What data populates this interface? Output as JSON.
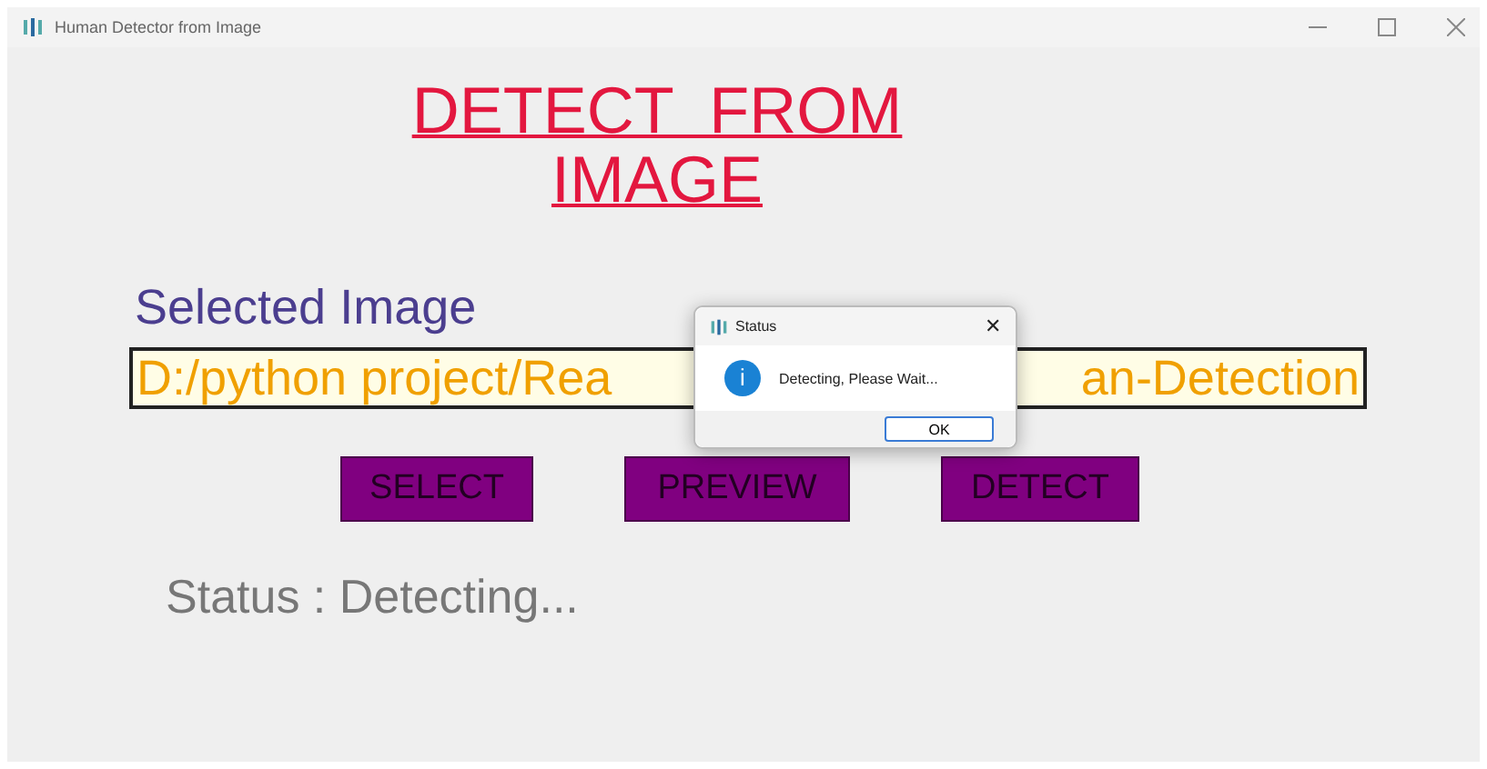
{
  "window": {
    "title": "Human Detector from Image"
  },
  "heading": [
    "DETECT  FROM",
    "IMAGE"
  ],
  "selected_label": "Selected Image",
  "path_field": {
    "visible_start": "D:/python project/Rea",
    "visible_end": "an-Detection"
  },
  "buttons": [
    {
      "label": "SELECT"
    },
    {
      "label": "PREVIEW"
    },
    {
      "label": "DETECT"
    }
  ],
  "status": "Status : Detecting...",
  "dialog": {
    "title": "Status",
    "close": "✕",
    "message": "Detecting, Please Wait...",
    "button": "OK",
    "info": "i"
  }
}
